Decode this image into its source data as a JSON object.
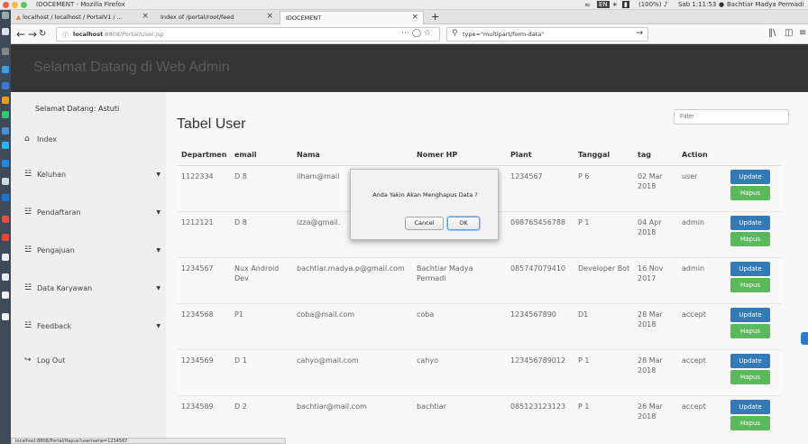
{
  "os": {
    "app_title": "IDOCEMENT - Mozilla Firefox",
    "battery": "(100%)",
    "clock": "Sab 1:11:53",
    "user": "Bachtiar Madya Permadi"
  },
  "browser": {
    "tabs": [
      {
        "label": "localhost / localhost / PortalV1 / ..."
      },
      {
        "label": "Index of /portal/root/feed"
      },
      {
        "label": "IDOCEMENT"
      }
    ],
    "url_host": "localhost",
    "url_rest": ":8808/Portal/User.jsp",
    "search_value": "type=\"multipart/form-data\"",
    "status_url": "localhost:8808/Portal/Hapus?username=1234567"
  },
  "brand": "Selamat Datang di Web Admin",
  "sidebar": {
    "welcome": "Selamat Datang: Astuti",
    "items": [
      {
        "label": "Index"
      },
      {
        "label": "Keluhan"
      },
      {
        "label": "Pendaftaran"
      },
      {
        "label": "Pengajuan"
      },
      {
        "label": "Data Karyawan"
      },
      {
        "label": "Feedback"
      },
      {
        "label": "Log Out"
      }
    ]
  },
  "main": {
    "title": "Tabel User",
    "filter_placeholder": "Filter",
    "columns": [
      "Departmen",
      "email",
      "Nama",
      "Nomer HP",
      "Plant",
      "Tanggal",
      "tag",
      "Action"
    ],
    "rows": [
      {
        "dept": "1122334",
        "email": "D 8",
        "nama": "ilham@mail",
        "hp": "",
        "plant": "1234567",
        "tanggal": "P 6",
        "tag": "02 Mar 2018",
        "action": "user"
      },
      {
        "dept": "1212121",
        "email": "D 8",
        "nama": "izza@gmail.",
        "hp": "",
        "plant": "098765456788",
        "tanggal": "P 1",
        "tag": "04 Apr 2018",
        "action": "admin"
      },
      {
        "dept": "1234567",
        "email": "Nux Android Dev",
        "nama": "bachtiar.madya.p@gmail.com",
        "hp": "Bachtiar Madya Permadi",
        "plant": "085747079410",
        "tanggal": "Developer Bot",
        "tag": "16 Nov 2017",
        "action": "admin"
      },
      {
        "dept": "1234568",
        "email": "P1",
        "nama": "coba@mail.com",
        "hp": "coba",
        "plant": "1234567890",
        "tanggal": "D1",
        "tag": "28 Mar 2018",
        "action": "accept"
      },
      {
        "dept": "1234569",
        "email": "D 1",
        "nama": "cahyo@mail.com",
        "hp": "cahyo",
        "plant": "123456789012",
        "tanggal": "P 1",
        "tag": "28 Mar 2018",
        "action": "accept"
      },
      {
        "dept": "1234589",
        "email": "D 2",
        "nama": "bachtiar@mail.com",
        "hp": "bachtiar",
        "plant": "085123123123",
        "tanggal": "P 1",
        "tag": "26 Mar 2018",
        "action": "accept"
      }
    ],
    "update_label": "Update",
    "delete_label": "Hapus"
  },
  "dialog": {
    "message": "Anda Yakin Akan Menghapus Data ?",
    "cancel_label": "Cancel",
    "ok_label": "OK"
  },
  "colors": {
    "brand_bar": "#353535",
    "update_button": "#337ab7",
    "delete_button": "#5cb85c"
  }
}
